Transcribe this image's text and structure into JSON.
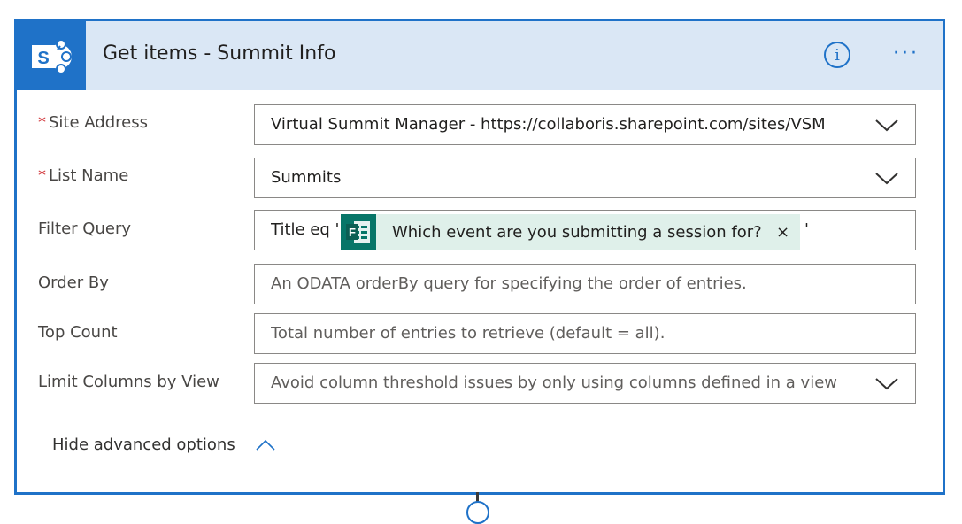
{
  "header": {
    "title": "Get items - Summit Info",
    "logo_icon": "sharepoint-logo-icon",
    "info_icon": "info-icon",
    "info_glyph": "i",
    "more_glyph": "···",
    "accent_color": "#1f72c8",
    "header_bg": "#dae7f5"
  },
  "fields": {
    "site_address": {
      "label": "Site Address",
      "required_marker": "*",
      "value": "Virtual Summit Manager - https://collaboris.sharepoint.com/sites/VSM"
    },
    "list_name": {
      "label": "List Name",
      "required_marker": "*",
      "value": "Summits"
    },
    "filter_query": {
      "label": "Filter Query",
      "prefix": "Title eq '",
      "token_label": "Which event are you submitting a session for?",
      "token_icon": "forms-icon",
      "token_close": "×",
      "suffix": "'"
    },
    "order_by": {
      "label": "Order By",
      "placeholder": "An ODATA orderBy query for specifying the order of entries."
    },
    "top_count": {
      "label": "Top Count",
      "placeholder": "Total number of entries to retrieve (default = all)."
    },
    "limit_columns": {
      "label": "Limit Columns by View",
      "placeholder": "Avoid column threshold issues by only using columns defined in a view"
    }
  },
  "advanced": {
    "label": "Hide advanced options"
  }
}
